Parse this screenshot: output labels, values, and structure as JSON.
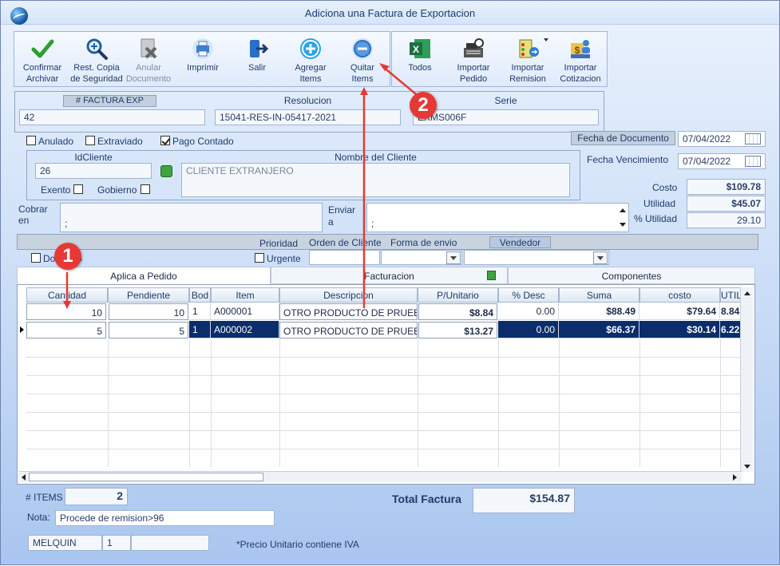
{
  "window": {
    "title": "Adiciona una Factura de Exportacion"
  },
  "toolbar": {
    "confirm": [
      "Confirmar",
      "Archivar"
    ],
    "restore": [
      "Rest. Copia",
      "de Seguridad"
    ],
    "annul": [
      "Anular",
      "Documento"
    ],
    "print": [
      "Imprimir"
    ],
    "exit": [
      "Salir"
    ],
    "add": [
      "Agregar",
      "Items"
    ],
    "remove": [
      "Quitar",
      "Items"
    ],
    "all": [
      "Todos"
    ],
    "import_order": [
      "Importar",
      "Pedido"
    ],
    "import_remision": [
      "Importar",
      "Remision"
    ],
    "import_quote": [
      "Importar",
      "Cotizacion"
    ]
  },
  "header": {
    "invoice_label": "# FACTURA EXP",
    "invoice_number": "42",
    "resolution_label": "Resolucion",
    "resolution": "15041-RES-IN-05417-2021",
    "series_label": "Serie",
    "series": "EXMS006F"
  },
  "flags": {
    "anulado": "Anulado",
    "extraviado": "Extraviado",
    "pago_contado": "Pago Contado"
  },
  "dates": {
    "doc_label": "Fecha de  Documento",
    "doc_date": "07/04/2022",
    "due_label": "Fecha Vencimiento",
    "due_date": "07/04/2022"
  },
  "client": {
    "id_label": "IdCliente",
    "id": "26",
    "name_label": "Nombre del Cliente",
    "name": "CLIENTE EXTRANJERO",
    "exento": "Exento",
    "gobierno": "Gobierno"
  },
  "summary": {
    "cost_label": "Costo",
    "cost": "$109.78",
    "util_label": "Utilidad",
    "util": "$45.07",
    "pct_label": "% Utilidad",
    "pct": "29.10"
  },
  "address": {
    "cobrar_label_1": "Cobrar",
    "cobrar_label_2": "en",
    "cobrar_value": ";",
    "enviar_label_1": "Enviar",
    "enviar_label_2": "a",
    "enviar_value": ";"
  },
  "options": {
    "prioridad": "Prioridad",
    "orden": "Orden de Cliente",
    "forma": "Forma de envio",
    "vendedor": "Vendedor",
    "domicilio": "Domicilio",
    "urgente": "Urgente"
  },
  "tabs": [
    "Aplica a Pedido",
    "Facturacion",
    "Componentes"
  ],
  "grid": {
    "columns": [
      "Cantidad",
      "Pendiente",
      "Bod",
      "Item",
      "Descripcion",
      "P/Unitario",
      "% Desc",
      "Suma",
      "costo",
      "UTIL"
    ],
    "rows": [
      [
        "10",
        "10",
        "1",
        "A000001",
        "OTRO PRODUCTO DE PRUEBA",
        "$8.84",
        "0.00",
        "$88.49",
        "$79.64",
        "8.84"
      ],
      [
        "5",
        "5",
        "1",
        "A000002",
        "OTRO PRODUCTO DE PRUEBA",
        "$13.27",
        "0.00",
        "$66.37",
        "$30.14",
        "6.22"
      ]
    ]
  },
  "footer": {
    "items_label": "# ITEMS",
    "items": "2",
    "total_label": "Total Factura",
    "total": "$154.87",
    "note_label": "Nota:",
    "note": "Procede de remision>96",
    "user": "MELQUIN",
    "user_num": "1",
    "iva_note": "*Precio Unitario contiene IVA"
  },
  "callouts": [
    "1",
    "2"
  ],
  "colors": {
    "accent": "#0b2d6b",
    "callout": "#e53935"
  }
}
